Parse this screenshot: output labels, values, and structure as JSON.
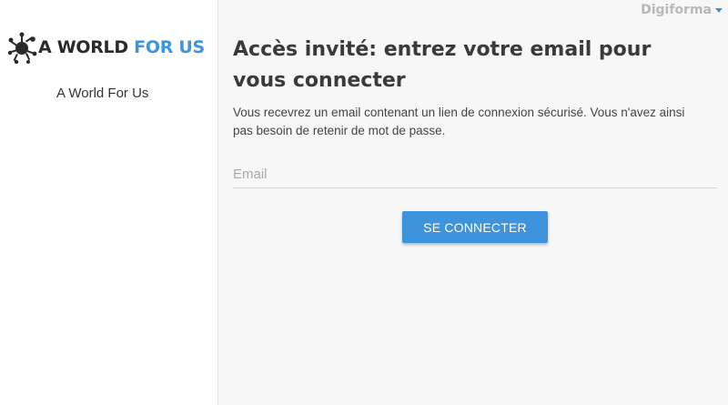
{
  "sidebar": {
    "logo": {
      "text_dark": "A WORLD",
      "text_blue": "FOR US",
      "icon": "splash-logo-icon"
    },
    "org_name": "A World For Us"
  },
  "header": {
    "brand": "Digiforma",
    "brand_menu_icon": "caret-down-icon"
  },
  "main": {
    "heading": "Accès invité: entrez votre email pour vous connecter",
    "description": "Vous recevrez un email contenant un lien de connexion sécurisé. Vous n'avez ainsi pas besoin de retenir de mot de passe.",
    "email": {
      "placeholder": "Email",
      "value": ""
    },
    "submit_label": "SE CONNECTER"
  },
  "colors": {
    "accent": "#3d94dd",
    "logo_dark": "#2a2a2a",
    "background": "#f7f7f7",
    "sidebar": "#ffffff"
  }
}
